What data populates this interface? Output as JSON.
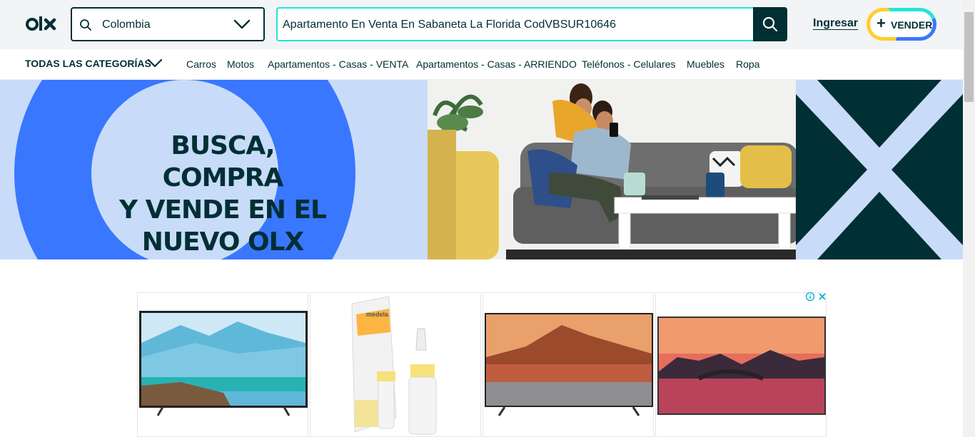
{
  "header": {
    "logo_text": "olx",
    "location": "Colombia",
    "search_query": "Apartamento En Venta En Sabaneta La Florida CodVBSUR10646",
    "login_label": "Ingresar",
    "sell_label": "VENDER"
  },
  "categories": {
    "all_label": "TODAS LAS CATEGORÍAS",
    "links": [
      "Carros",
      "Motos",
      "Apartamentos - Casas - VENTA",
      "Apartamentos - Casas - ARRIENDO",
      "Teléfonos - Celulares",
      "Muebles",
      "Ropa"
    ]
  },
  "banner": {
    "headline_line1": "BUSCA, COMPRA",
    "headline_line2": "Y VENDE EN EL",
    "headline_line3": "NUEVO OLX"
  },
  "ads": {
    "product_brand": "medela"
  },
  "colors": {
    "brand_dark": "#002f34",
    "accent_teal": "#23e5db",
    "accent_blue": "#3a77ff",
    "accent_yellow": "#ffce32",
    "banner_light_blue": "#c8dcfa"
  },
  "icons": [
    "olx-logo",
    "search-icon",
    "chevron-down-icon",
    "plus-icon",
    "info-icon",
    "close-icon"
  ]
}
